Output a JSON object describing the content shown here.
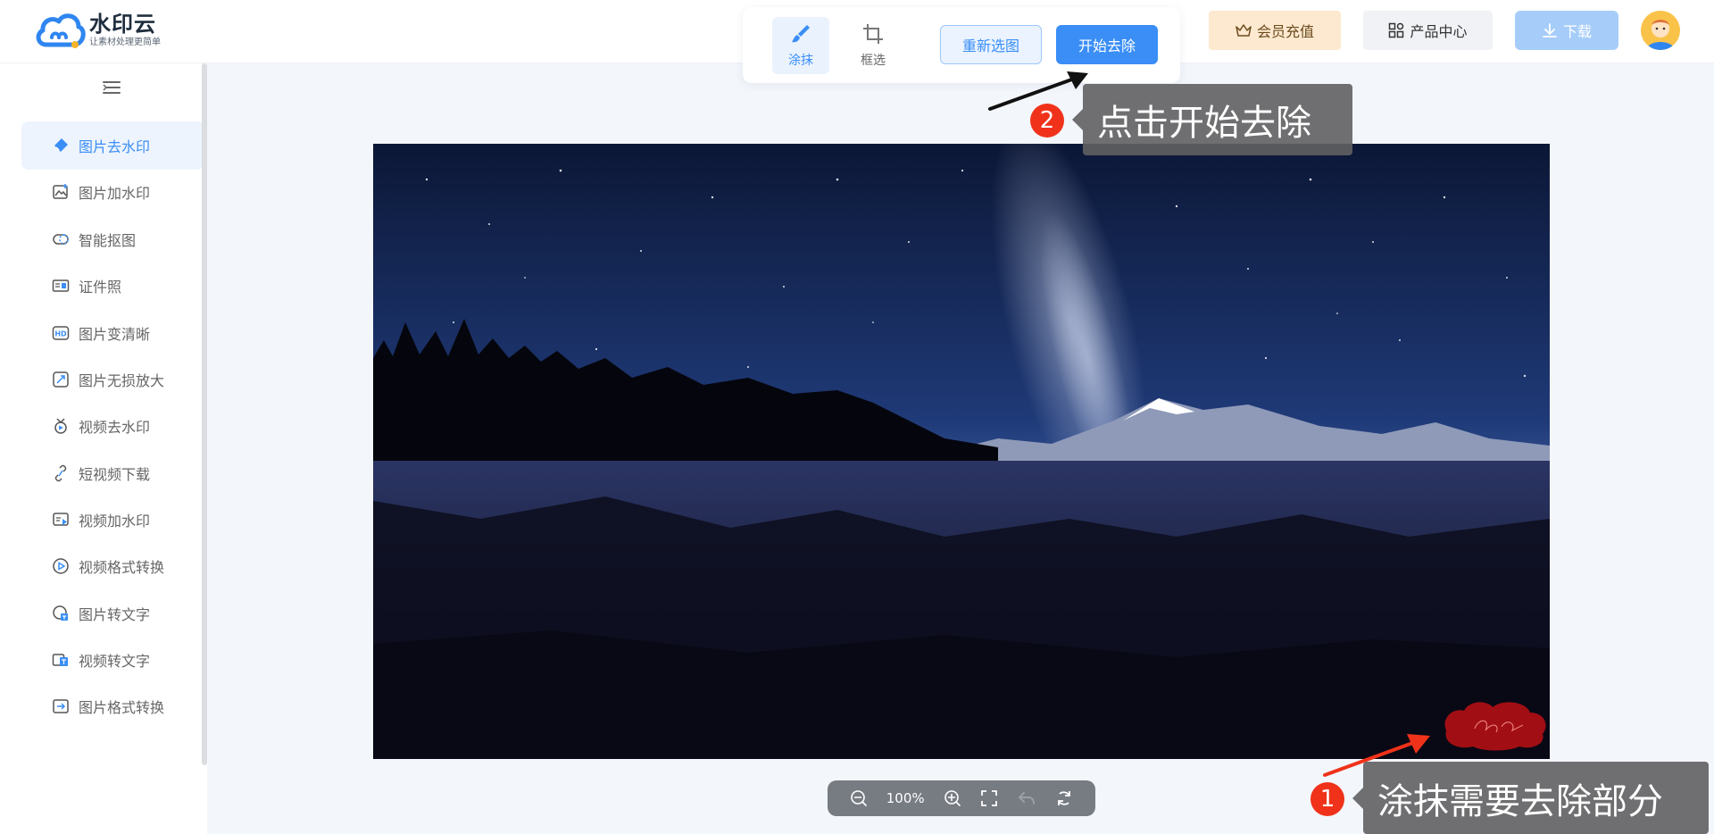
{
  "header": {
    "logo": {
      "title": "水印云",
      "subtitle": "让素材处理更简单"
    },
    "tools": {
      "smear_label": "涂抹",
      "box_label": "框选"
    },
    "reselect_label": "重新选图",
    "start_label": "开始去除",
    "vip_label": "会员充值",
    "products_label": "产品中心",
    "download_label": "下载"
  },
  "sidebar": {
    "items": [
      {
        "label": "图片去水印",
        "icon": "eraser-icon",
        "active": true
      },
      {
        "label": "图片加水印",
        "icon": "image-add-icon"
      },
      {
        "label": "智能抠图",
        "icon": "cutout-icon"
      },
      {
        "label": "证件照",
        "icon": "id-card-icon"
      },
      {
        "label": "图片变清晰",
        "icon": "hd-icon"
      },
      {
        "label": "图片无损放大",
        "icon": "enlarge-icon"
      },
      {
        "label": "视频去水印",
        "icon": "video-eraser-icon"
      },
      {
        "label": "短视频下载",
        "icon": "link-icon"
      },
      {
        "label": "视频加水印",
        "icon": "video-add-icon"
      },
      {
        "label": "视频格式转换",
        "icon": "video-convert-icon"
      },
      {
        "label": "图片转文字",
        "icon": "image-text-icon"
      },
      {
        "label": "视频转文字",
        "icon": "video-text-icon"
      },
      {
        "label": "图片格式转换",
        "icon": "image-convert-icon"
      }
    ]
  },
  "zoom": {
    "level": "100%"
  },
  "callouts": {
    "step1_number": "1",
    "step1_text": "涂抹需要去除部分",
    "step2_number": "2",
    "step2_text": "点击开始去除"
  },
  "colors": {
    "accent": "#3a8ef6",
    "badge": "#f0321a",
    "smear": "#b30f14"
  }
}
